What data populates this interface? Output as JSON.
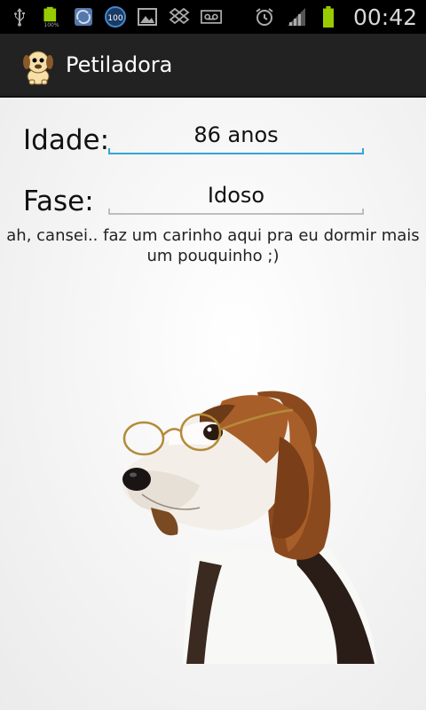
{
  "status_bar": {
    "time": "00:42",
    "icons": [
      "usb-icon",
      "battery-100-icon",
      "sync-icon",
      "sync-100-icon",
      "image-icon",
      "dropbox-icon",
      "voicemail-icon",
      "alarm-icon",
      "signal-icon",
      "battery-icon"
    ],
    "colors": {
      "battery": "#99cc00",
      "text": "#d8d8d8"
    }
  },
  "app": {
    "title": "Petiladora",
    "icon": "dog-logo-icon"
  },
  "form": {
    "age_label": "Idade:",
    "age_value": "86 anos",
    "phase_label": "Fase:",
    "phase_value": "Idoso"
  },
  "message": "ah, cansei.. faz um carinho aqui pra eu dormir mais um pouquinho ;)",
  "colors": {
    "accent": "#33a5d6",
    "actionbar": "#222222"
  }
}
